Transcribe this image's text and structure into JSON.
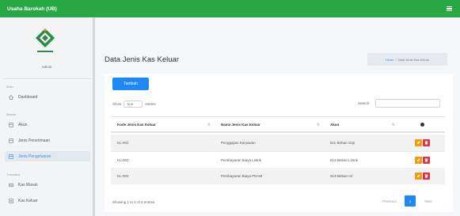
{
  "app": {
    "brand": "Usaha Barokah (UB)"
  },
  "sidebar": {
    "user_name": "Admin",
    "sections": [
      {
        "heading": "Main",
        "items": [
          {
            "label": "Dashboard",
            "icon": "home-icon"
          }
        ]
      },
      {
        "heading": "Master",
        "items": [
          {
            "label": "Akun",
            "icon": "list-icon"
          },
          {
            "label": "Jenis Penerimaan",
            "icon": "list-icon"
          },
          {
            "label": "Jenis Pengeluaran",
            "icon": "list-icon",
            "active": true
          }
        ]
      },
      {
        "heading": "Transaksi",
        "items": [
          {
            "label": "Kas Masuk",
            "icon": "download-icon"
          },
          {
            "label": "Kas Keluar",
            "icon": "upload-icon"
          }
        ]
      }
    ]
  },
  "page": {
    "title": "Data Jenis Kas Keluar",
    "breadcrumb": {
      "home": "Home",
      "separator": "/",
      "current": "Data Jenis Kas Keluar"
    }
  },
  "toolbar": {
    "add_label": "Tambah"
  },
  "table_controls": {
    "show_label": "Show",
    "entries_value": "10",
    "entries_label": "entries",
    "search_label": "Search:",
    "search_value": ""
  },
  "table": {
    "columns": [
      "Kode Jenis Kas Keluar",
      "Nama Jenis Kas Keluar",
      "Akun",
      "gear-icon"
    ],
    "rows": [
      [
        "KL-001",
        "Penggajian Karyawan",
        "511-Beban Gaji"
      ],
      [
        "KL-002",
        "Pembayaran Biaya Listrik",
        "512-Beban Listrik"
      ],
      [
        "KL-003",
        "Pembayaran Biaya PDAM",
        "513-Beban Air"
      ]
    ]
  },
  "footer": {
    "showing": "Showing 1 to 3 of 3 entries",
    "previous": "Previous",
    "page": "1",
    "next": "Next"
  },
  "colors": {
    "topbar": "#28a745",
    "primary": "#1e88f5",
    "edit": "#f39c12",
    "delete": "#dc3545"
  }
}
